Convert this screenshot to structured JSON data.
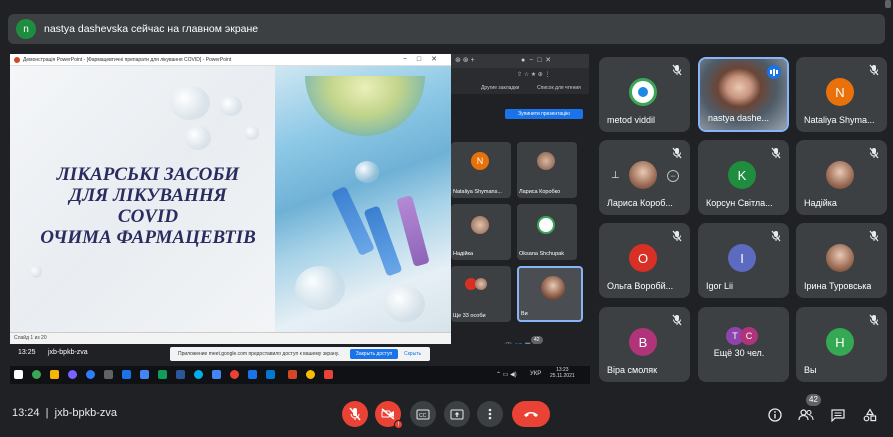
{
  "banner": {
    "avatar_letter": "n",
    "text": "nastya dashevska сейчас на главном экране"
  },
  "presentation": {
    "window_title": "Демонстрація PowerPoint - [Фармацевтичні препарати для лікування COVID] - PowerPoint",
    "slide_lines": [
      "ЛІКАРСЬКІ ЗАСОБИ",
      "ДЛЯ ЛІКУВАННЯ",
      "COVID",
      "ОЧИМА ФАРМАЦЕВТІВ"
    ],
    "status": "Слайд 1 из 20"
  },
  "embedded": {
    "bookmarks": [
      "Другие закладки",
      "Список для чтения"
    ],
    "present_button": "Зупинити презентацію",
    "tiles": [
      {
        "name": "Nataliya Shymans...",
        "letter": "N",
        "color": "#e8710a"
      },
      {
        "name": "Лариса Коробко",
        "letter": "",
        "color": ""
      },
      {
        "name": "Надійка",
        "letter": "",
        "color": ""
      },
      {
        "name": "Oksana Shchupak",
        "letter": "",
        "color": ""
      },
      {
        "name": "Ще 33 особи",
        "letter": "",
        "color": ""
      },
      {
        "name": "Ви",
        "letter": "",
        "color": ""
      }
    ],
    "time": "13:25",
    "code": "jxb-bpkb-zva",
    "badge": "42"
  },
  "notification": {
    "text": "Приложение meet.google.com предоставило доступ к вашему экрану.",
    "stop": "Закрыть доступ",
    "hide": "Скрыть"
  },
  "taskbar": {
    "lang": "УКР",
    "time": "13:23",
    "date": "25.11.2021"
  },
  "participants": [
    {
      "name": "metod viddil",
      "type": "logo",
      "letter": "",
      "color": ""
    },
    {
      "name": "nastya dashe...",
      "type": "photo",
      "letter": "",
      "color": "",
      "speaking": true
    },
    {
      "name": "Nataliya Shyma...",
      "type": "letter",
      "letter": "N",
      "color": "#e8710a"
    },
    {
      "name": "Лариса Короб...",
      "type": "photo",
      "letter": "",
      "color": ""
    },
    {
      "name": "Корсун Світла...",
      "type": "letter",
      "letter": "K",
      "color": "#1e8e3e"
    },
    {
      "name": "Надійка",
      "type": "photo",
      "letter": "",
      "color": ""
    },
    {
      "name": "Ольга Воробй...",
      "type": "letter",
      "letter": "О",
      "color": "#d93025"
    },
    {
      "name": "Igor Lii",
      "type": "letter",
      "letter": "I",
      "color": "#5c6bc0"
    },
    {
      "name": "Ірина Туровська",
      "type": "photo",
      "letter": "",
      "color": ""
    },
    {
      "name": "Віра смоляк",
      "type": "letter",
      "letter": "В",
      "color": "#b0347a"
    },
    {
      "name": "Ещё 30 чел.",
      "type": "more",
      "letter": "",
      "color": ""
    },
    {
      "name": "Вы",
      "type": "letter",
      "letter": "H",
      "color": "#34a853"
    }
  ],
  "more_avatars": [
    "T",
    "C"
  ],
  "bottom": {
    "time": "13:24",
    "separator": "|",
    "code": "jxb-bpkb-zva",
    "people_count": "42"
  },
  "icons": {
    "mic_off": "mic-off-icon",
    "cam_off": "camera-off-icon",
    "cc": "captions-icon",
    "present": "present-icon",
    "more": "more-vert-icon",
    "hangup": "hangup-icon",
    "info": "info-icon",
    "people": "people-icon",
    "chat": "chat-icon",
    "activities": "activities-icon"
  }
}
